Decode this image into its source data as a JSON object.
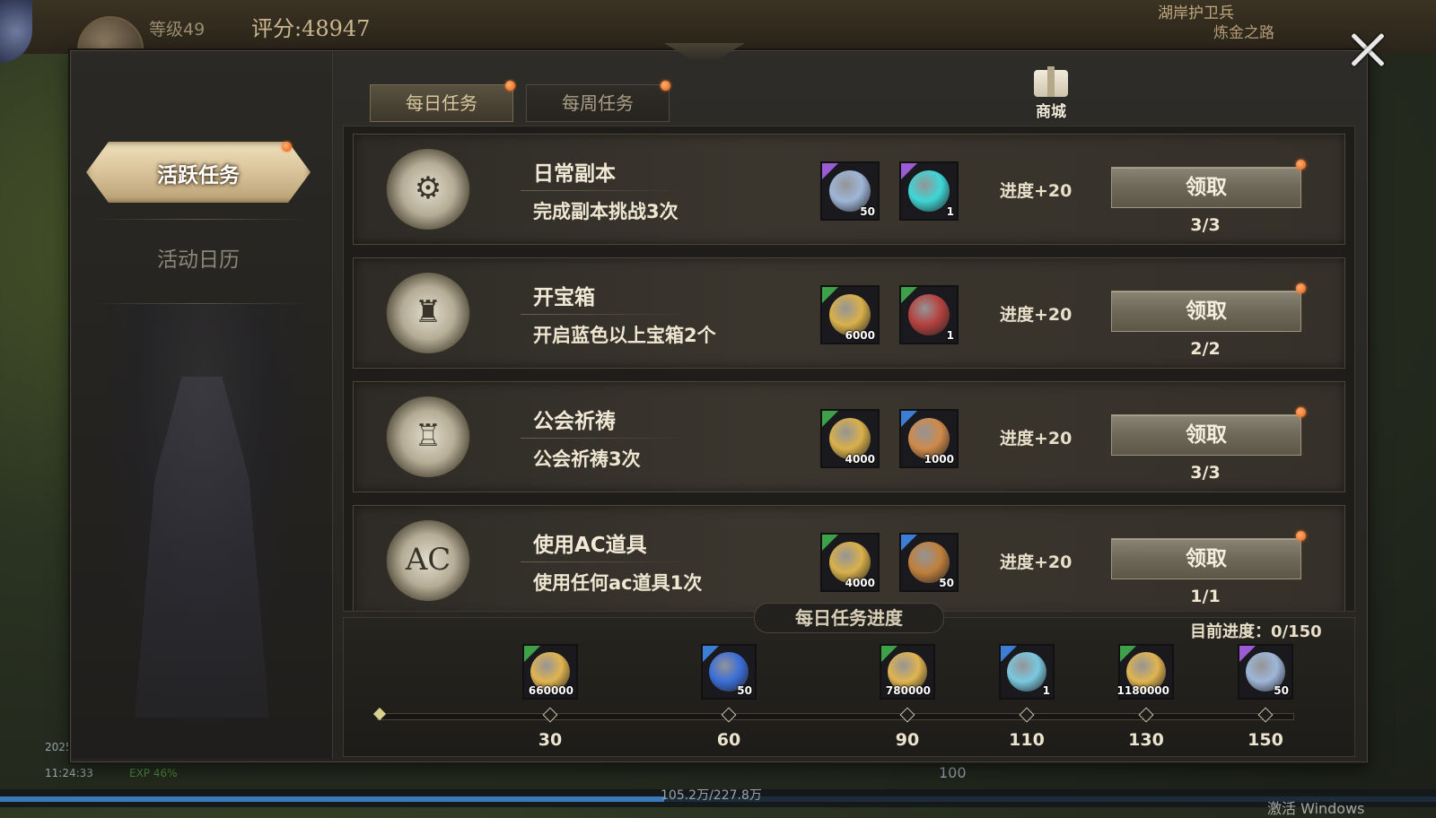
{
  "hud": {
    "level": "等级49",
    "score": "评分:48947",
    "quest_title": "湖岸护卫兵",
    "quest_sub": "炼金之路",
    "date": "2025",
    "time": "11:24:33",
    "exp_pct": "EXP 46%",
    "exp_text": "105.2万/227.8万",
    "count_100": "100",
    "watermark": "激活 Windows"
  },
  "sidebar": {
    "items": [
      {
        "label": "活跃任务",
        "active": true
      },
      {
        "label": "活动日历",
        "active": false
      }
    ]
  },
  "tabs": [
    {
      "label": "每日任务",
      "active": true
    },
    {
      "label": "每周任务",
      "active": false
    }
  ],
  "shop": {
    "label": "商城",
    "icon": "gift-icon"
  },
  "tasks": [
    {
      "title": "日常副本",
      "desc": "完成副本挑战3次",
      "icon": "dungeon-icon",
      "glyph": "⚙",
      "rewards": [
        {
          "icon": "scroll-stone-icon",
          "qty": "50",
          "corner": "#9b5bd3",
          "art": "#9fb6d8"
        },
        {
          "icon": "crystal-icon",
          "qty": "1",
          "corner": "#9b5bd3",
          "art": "#3fd6d6"
        }
      ],
      "progress_plus": "进度+20",
      "claim": "领取",
      "count": "3/3"
    },
    {
      "title": "开宝箱",
      "desc": "开启蓝色以上宝箱2个",
      "icon": "treasure-chest-icon",
      "glyph": "♜",
      "rewards": [
        {
          "icon": "gold-coin-icon",
          "qty": "6000",
          "corner": "#3fa04a",
          "art": "#d9b04a"
        },
        {
          "icon": "hammer-icon",
          "qty": "1",
          "corner": "#3fa04a",
          "art": "#b5413e"
        }
      ],
      "progress_plus": "进度+20",
      "claim": "领取",
      "count": "2/2"
    },
    {
      "title": "公会祈祷",
      "desc": "公会祈祷3次",
      "icon": "guild-icon",
      "glyph": "♖",
      "rewards": [
        {
          "icon": "gold-coin-icon",
          "qty": "4000",
          "corner": "#3fa04a",
          "art": "#d9b04a"
        },
        {
          "icon": "bone-icon",
          "qty": "1000",
          "corner": "#3c7ed6",
          "art": "#d08a4a"
        }
      ],
      "progress_plus": "进度+20",
      "claim": "领取",
      "count": "3/3"
    },
    {
      "title": "使用AC道具",
      "desc": "使用任何ac道具1次",
      "icon": "ac-item-icon",
      "glyph": "AC",
      "rewards": [
        {
          "icon": "gold-coin-icon",
          "qty": "4000",
          "corner": "#3fa04a",
          "art": "#d9b04a"
        },
        {
          "icon": "gold-pile-icon",
          "qty": "50",
          "corner": "#3c7ed6",
          "art": "#c0803c"
        }
      ],
      "progress_plus": "进度+20",
      "claim": "领取",
      "count": "1/1"
    }
  ],
  "daily_progress": {
    "title": "每日任务进度",
    "current": "目前进度：0/150",
    "current_value": 0,
    "max": 150,
    "milestones": [
      {
        "value": "30",
        "qty": "660000",
        "icon": "gold-bar-icon",
        "corner": "#3fa04a",
        "art": "#e0b450"
      },
      {
        "value": "60",
        "qty": "50",
        "icon": "blue-gem-icon",
        "corner": "#3c7ed6",
        "art": "#3a6ed8"
      },
      {
        "value": "90",
        "qty": "780000",
        "icon": "gold-bar-icon",
        "corner": "#3fa04a",
        "art": "#e0b450"
      },
      {
        "value": "110",
        "qty": "1",
        "icon": "key-icon",
        "corner": "#3c7ed6",
        "art": "#7ac8e0"
      },
      {
        "value": "130",
        "qty": "1180000",
        "icon": "gold-bar-icon",
        "corner": "#3fa04a",
        "art": "#e0b450"
      },
      {
        "value": "150",
        "qty": "50",
        "icon": "scroll-stone-icon",
        "corner": "#9b5bd3",
        "art": "#9fb6d8"
      }
    ]
  }
}
